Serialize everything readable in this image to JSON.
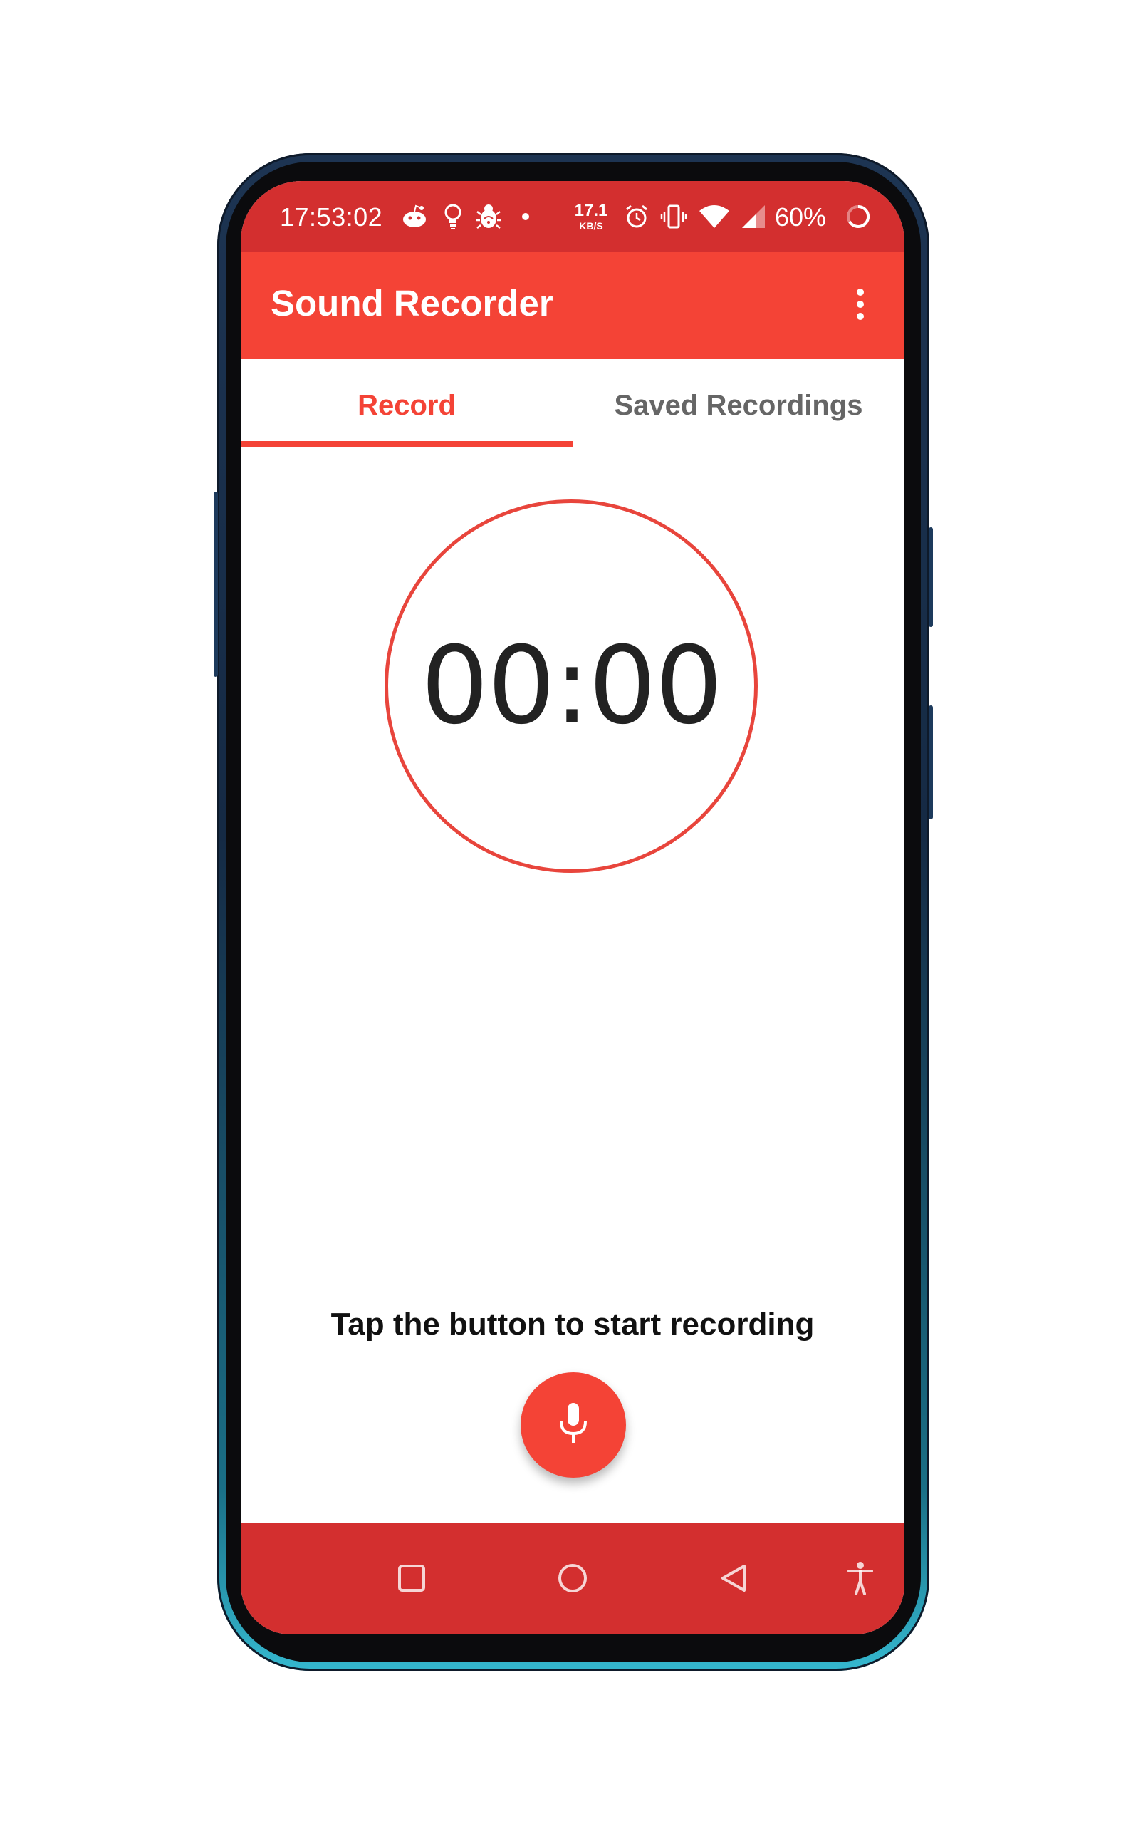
{
  "status_bar": {
    "time": "17:53:02",
    "net_speed_value": "17.1",
    "net_speed_unit": "KB/S",
    "battery": "60%",
    "icons": [
      "reddit-icon",
      "bulb-icon",
      "bug-icon",
      "dot-icon",
      "alarm-icon",
      "vibrate-icon",
      "wifi-icon",
      "signal-icon",
      "battery-icon"
    ]
  },
  "app_bar": {
    "title": "Sound Recorder",
    "overflow_icon": "more-vert-icon"
  },
  "tabs": [
    {
      "label": "Record",
      "selected": true
    },
    {
      "label": "Saved Recordings",
      "selected": false
    }
  ],
  "timer": {
    "value": "00:00"
  },
  "hint": "Tap the button to start recording",
  "fab": {
    "icon": "microphone-icon"
  },
  "nav_bar": {
    "icons": [
      "recents-icon",
      "home-icon",
      "back-icon",
      "accessibility-icon"
    ]
  },
  "colors": {
    "primary": "#f44336",
    "primary_dark": "#d32f2f",
    "tab_inactive": "#666666",
    "timer_text": "#222222"
  }
}
